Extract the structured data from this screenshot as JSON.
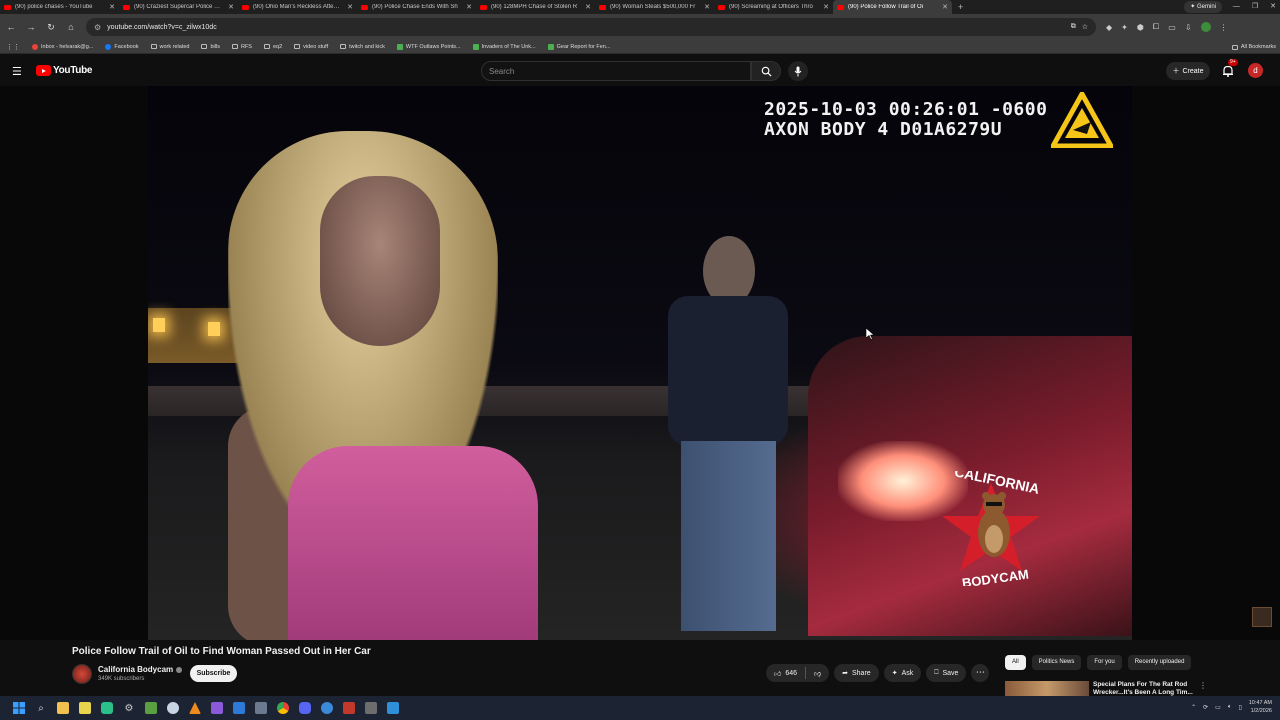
{
  "browser": {
    "tabs": [
      {
        "title": "(90) police chases - YouTube",
        "active": false
      },
      {
        "title": "(90) Craziest Supercar Police Chases",
        "active": false
      },
      {
        "title": "(90) Ohio Man's Reckless Attempt",
        "active": false
      },
      {
        "title": "(90) Police Chase Ends With Sh",
        "active": false
      },
      {
        "title": "(90) 128MPH Chase of Stolen R",
        "active": false
      },
      {
        "title": "(90) Woman Steals $500,000 Fr",
        "active": false
      },
      {
        "title": "(90) Screaming at Officers Thro",
        "active": false
      },
      {
        "title": "(90) Police Follow Trail of Oi",
        "active": true
      }
    ],
    "gemini_label": "Gemini",
    "url": "youtube.com/watch?v=c_zilwx10dc",
    "profile_initial": "E",
    "bookmarks": [
      {
        "label": "Inbox - helvarak@g...",
        "type": "gmail"
      },
      {
        "label": "Facebook",
        "type": "facebook"
      },
      {
        "label": "work related",
        "type": "folder"
      },
      {
        "label": "bills",
        "type": "folder"
      },
      {
        "label": "RFS",
        "type": "folder"
      },
      {
        "label": "eq2",
        "type": "folder"
      },
      {
        "label": "video stuff",
        "type": "folder"
      },
      {
        "label": "twitch and kick",
        "type": "folder"
      },
      {
        "label": "WTF Outlaws Points...",
        "type": "site"
      },
      {
        "label": "Invaders of The Unk...",
        "type": "site"
      },
      {
        "label": "Gear Report for Fen...",
        "type": "site"
      }
    ],
    "all_bookmarks_label": "All Bookmarks"
  },
  "youtube": {
    "logo_text": "YouTube",
    "search_placeholder": "Search",
    "create_label": "Create",
    "notification_count": "9+",
    "avatar_initial": "d"
  },
  "video": {
    "timestamp": "2025-10-03 00:26:01 -0600",
    "camera_id": "AXON BODY 4 D01A6279U",
    "watermark_top": "CALIFORNIA",
    "watermark_bottom": "BODYCAM",
    "title": "Police Follow Trail of Oil to Find Woman Passed Out in Her Car",
    "channel_name": "California Bodycam",
    "subscribers": "349K subscribers",
    "subscribe_label": "Subscribe",
    "likes": "646",
    "share_label": "Share",
    "ask_label": "Ask",
    "save_label": "Save"
  },
  "sidebar": {
    "chips": [
      {
        "label": "All",
        "selected": true
      },
      {
        "label": "Politics News",
        "selected": false
      },
      {
        "label": "For you",
        "selected": false
      },
      {
        "label": "Recently uploaded",
        "selected": false
      }
    ],
    "rec_title": "Special Plans For The Rat Rod Wrecker...It's Been A Long Tim..."
  },
  "taskbar": {
    "time": "10:47 AM",
    "date": "1/2/2026"
  },
  "colors": {
    "brand_red": "#ff0000",
    "bg": "#0f0f0f",
    "osd_text": "#f2f2f2",
    "axon_yellow": "#f5c518"
  }
}
